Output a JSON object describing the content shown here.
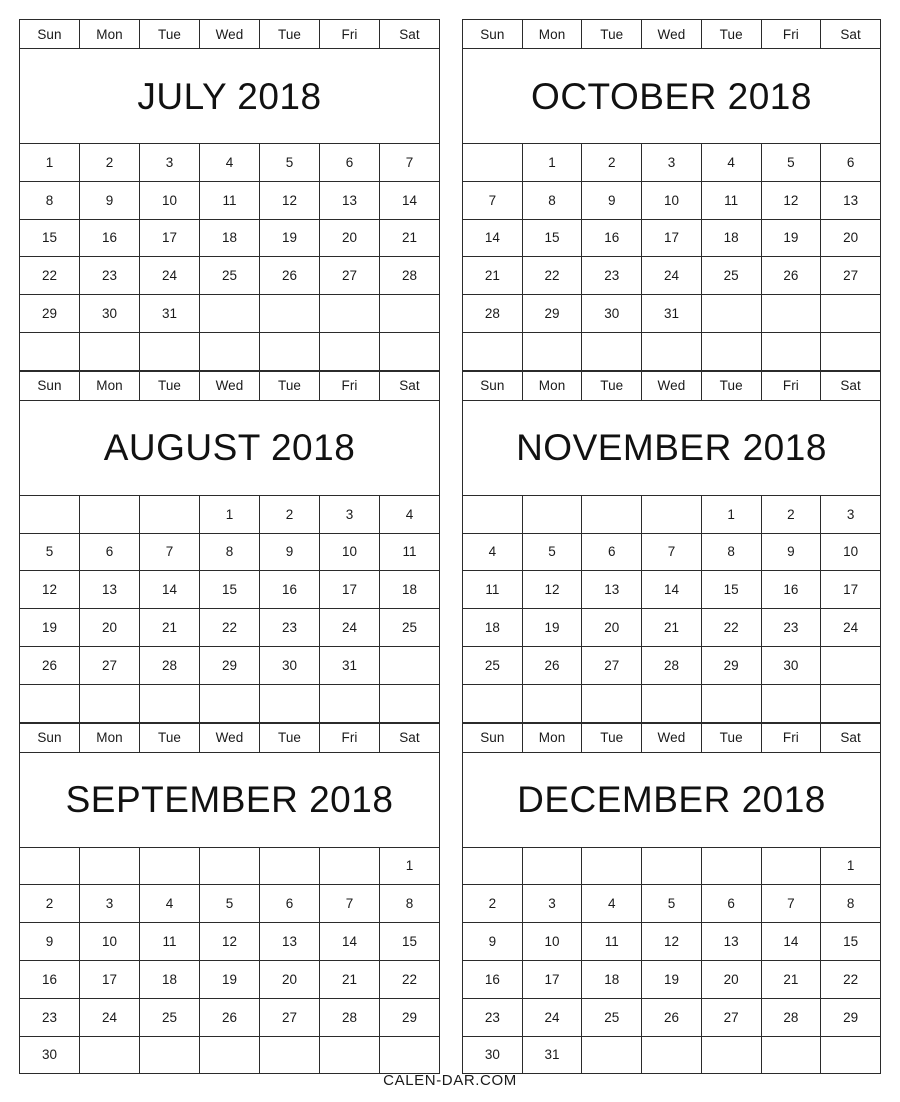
{
  "footer": {
    "text": "CALEN-DAR.COM"
  },
  "weekday_headers": [
    "Sun",
    "Mon",
    "Tue",
    "Wed",
    "Tue",
    "Fri",
    "Sat"
  ],
  "columns": [
    {
      "name": "left-column",
      "months": [
        {
          "title": "JULY 2018",
          "month_name": "JULY",
          "year": "2018",
          "start_weekday_index": 0,
          "num_days": 31,
          "weeks": [
            [
              "1",
              "2",
              "3",
              "4",
              "5",
              "6",
              "7"
            ],
            [
              "8",
              "9",
              "10",
              "11",
              "12",
              "13",
              "14"
            ],
            [
              "15",
              "16",
              "17",
              "18",
              "19",
              "20",
              "21"
            ],
            [
              "22",
              "23",
              "24",
              "25",
              "26",
              "27",
              "28"
            ],
            [
              "29",
              "30",
              "31",
              "",
              "",
              "",
              ""
            ],
            [
              "",
              "",
              "",
              "",
              "",
              "",
              ""
            ]
          ]
        },
        {
          "title": "AUGUST 2018",
          "month_name": "AUGUST",
          "year": "2018",
          "start_weekday_index": 3,
          "num_days": 31,
          "weeks": [
            [
              "",
              "",
              "",
              "1",
              "2",
              "3",
              "4"
            ],
            [
              "5",
              "6",
              "7",
              "8",
              "9",
              "10",
              "11"
            ],
            [
              "12",
              "13",
              "14",
              "15",
              "16",
              "17",
              "18"
            ],
            [
              "19",
              "20",
              "21",
              "22",
              "23",
              "24",
              "25"
            ],
            [
              "26",
              "27",
              "28",
              "29",
              "30",
              "31",
              ""
            ],
            [
              "",
              "",
              "",
              "",
              "",
              "",
              ""
            ]
          ]
        },
        {
          "title": "SEPTEMBER 2018",
          "month_name": "SEPTEMBER",
          "year": "2018",
          "start_weekday_index": 6,
          "num_days": 30,
          "weeks": [
            [
              "",
              "",
              "",
              "",
              "",
              "",
              "1"
            ],
            [
              "2",
              "3",
              "4",
              "5",
              "6",
              "7",
              "8"
            ],
            [
              "9",
              "10",
              "11",
              "12",
              "13",
              "14",
              "15"
            ],
            [
              "16",
              "17",
              "18",
              "19",
              "20",
              "21",
              "22"
            ],
            [
              "23",
              "24",
              "25",
              "26",
              "27",
              "28",
              "29"
            ],
            [
              "30",
              "",
              "",
              "",
              "",
              "",
              ""
            ]
          ]
        }
      ]
    },
    {
      "name": "right-column",
      "months": [
        {
          "title": "OCTOBER 2018",
          "month_name": "OCTOBER",
          "year": "2018",
          "start_weekday_index": 1,
          "num_days": 31,
          "weeks": [
            [
              "",
              "1",
              "2",
              "3",
              "4",
              "5",
              "6"
            ],
            [
              "7",
              "8",
              "9",
              "10",
              "11",
              "12",
              "13"
            ],
            [
              "14",
              "15",
              "16",
              "17",
              "18",
              "19",
              "20"
            ],
            [
              "21",
              "22",
              "23",
              "24",
              "25",
              "26",
              "27"
            ],
            [
              "28",
              "29",
              "30",
              "31",
              "",
              "",
              ""
            ],
            [
              "",
              "",
              "",
              "",
              "",
              "",
              ""
            ]
          ]
        },
        {
          "title": "NOVEMBER 2018",
          "month_name": "NOVEMBER",
          "year": "2018",
          "start_weekday_index": 4,
          "num_days": 30,
          "weeks": [
            [
              "",
              "",
              "",
              "",
              "1",
              "2",
              "3"
            ],
            [
              "4",
              "5",
              "6",
              "7",
              "8",
              "9",
              "10"
            ],
            [
              "11",
              "12",
              "13",
              "14",
              "15",
              "16",
              "17"
            ],
            [
              "18",
              "19",
              "20",
              "21",
              "22",
              "23",
              "24"
            ],
            [
              "25",
              "26",
              "27",
              "28",
              "29",
              "30",
              ""
            ],
            [
              "",
              "",
              "",
              "",
              "",
              "",
              ""
            ]
          ]
        },
        {
          "title": "DECEMBER 2018",
          "month_name": "DECEMBER",
          "year": "2018",
          "start_weekday_index": 6,
          "num_days": 31,
          "weeks": [
            [
              "",
              "",
              "",
              "",
              "",
              "",
              "1"
            ],
            [
              "2",
              "3",
              "4",
              "5",
              "6",
              "7",
              "8"
            ],
            [
              "9",
              "10",
              "11",
              "12",
              "13",
              "14",
              "15"
            ],
            [
              "16",
              "17",
              "18",
              "19",
              "20",
              "21",
              "22"
            ],
            [
              "23",
              "24",
              "25",
              "26",
              "27",
              "28",
              "29"
            ],
            [
              "30",
              "31",
              "",
              "",
              "",
              "",
              ""
            ]
          ]
        }
      ]
    }
  ]
}
